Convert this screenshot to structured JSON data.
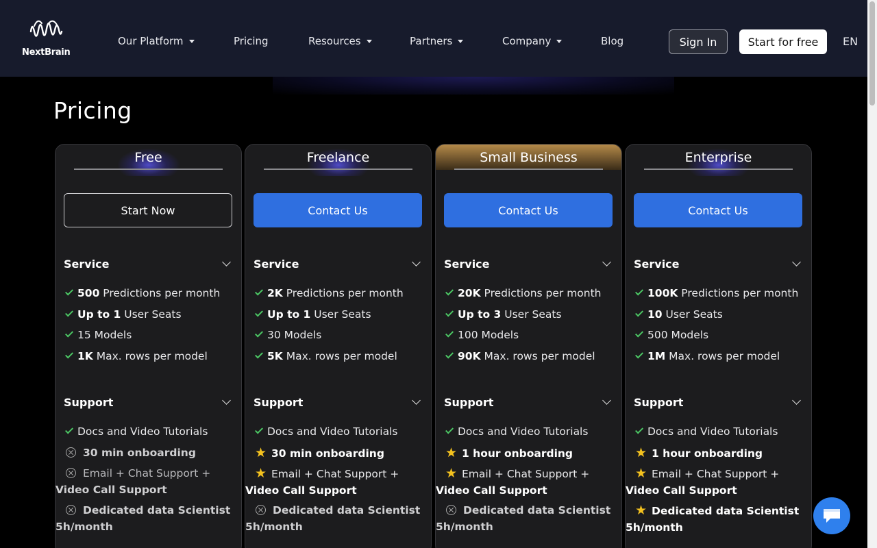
{
  "header": {
    "logo_text": "NextBrain",
    "nav": [
      {
        "label": "Our Platform",
        "has_menu": true
      },
      {
        "label": "Pricing",
        "has_menu": false
      },
      {
        "label": "Resources",
        "has_menu": true
      },
      {
        "label": "Partners",
        "has_menu": true
      },
      {
        "label": "Company",
        "has_menu": true
      },
      {
        "label": "Blog",
        "has_menu": false
      }
    ],
    "signin_label": "Sign In",
    "start_label": "Start for free",
    "lang": "EN"
  },
  "page_title": "Pricing",
  "colors": {
    "accent": "#2f6fe0",
    "check": "#4cc764",
    "star": "#f4c21f",
    "gold": "#b58a49"
  },
  "plans": [
    {
      "name": "Free",
      "cta": "Start Now",
      "service_label": "Service",
      "service": [
        {
          "bold": "500",
          "text": " Predictions per month"
        },
        {
          "bold": "Up to 1",
          "text": " User Seats"
        },
        {
          "bold": "",
          "text": "15 Models"
        },
        {
          "bold": "1K",
          "text": " Max. rows per model"
        }
      ],
      "support_label": "Support",
      "support": [
        {
          "icon": "check-icon",
          "text": "Docs and Video Tutorials"
        },
        {
          "icon": "x-circle-icon",
          "text": "30 min onboarding"
        },
        {
          "icon": "x-circle-icon",
          "text": "Email + Chat Support +",
          "text2": "Video Call Support"
        },
        {
          "icon": "x-circle-icon",
          "text": "Dedicated data Scientist",
          "text2": "5h/month"
        }
      ]
    },
    {
      "name": "Freelance",
      "cta": "Contact Us",
      "service_label": "Service",
      "service": [
        {
          "bold": "2K",
          "text": " Predictions per month"
        },
        {
          "bold": "Up to 1",
          "text": " User Seats"
        },
        {
          "bold": "",
          "text": "30 Models"
        },
        {
          "bold": "5K",
          "text": " Max. rows per model"
        }
      ],
      "support_label": "Support",
      "support": [
        {
          "icon": "check-icon",
          "text": "Docs and Video Tutorials"
        },
        {
          "icon": "star-icon",
          "text": "30 min onboarding"
        },
        {
          "icon": "star-icon",
          "text": "Email + Chat Support +",
          "text2": "Video Call Support"
        },
        {
          "icon": "x-circle-icon",
          "text": "Dedicated data Scientist",
          "text2": "5h/month"
        }
      ]
    },
    {
      "name": "Small Business",
      "cta": "Contact Us",
      "service_label": "Service",
      "service": [
        {
          "bold": "20K",
          "text": " Predictions per month"
        },
        {
          "bold": "Up to 3",
          "text": " User Seats"
        },
        {
          "bold": "",
          "text": "100 Models"
        },
        {
          "bold": "90K",
          "text": " Max. rows per model"
        }
      ],
      "support_label": "Support",
      "support": [
        {
          "icon": "check-icon",
          "text": "Docs and Video Tutorials"
        },
        {
          "icon": "star-icon",
          "text": "1 hour onboarding"
        },
        {
          "icon": "star-icon",
          "text": "Email + Chat Support +",
          "text2": "Video Call Support"
        },
        {
          "icon": "x-circle-icon",
          "text": "Dedicated data Scientist",
          "text2": "5h/month"
        }
      ]
    },
    {
      "name": "Enterprise",
      "cta": "Contact Us",
      "service_label": "Service",
      "service": [
        {
          "bold": "100K",
          "text": " Predictions per month"
        },
        {
          "bold": "10",
          "text": " User Seats"
        },
        {
          "bold": "",
          "text": "500 Models"
        },
        {
          "bold": "1M",
          "text": " Max. rows per model"
        }
      ],
      "support_label": "Support",
      "support": [
        {
          "icon": "check-icon",
          "text": "Docs and Video Tutorials"
        },
        {
          "icon": "star-icon",
          "text": "1 hour onboarding"
        },
        {
          "icon": "star-icon",
          "text": "Email + Chat Support +",
          "text2": "Video Call Support"
        },
        {
          "icon": "star-icon",
          "text": "Dedicated data Scientist",
          "text2": "5h/month"
        }
      ]
    }
  ]
}
